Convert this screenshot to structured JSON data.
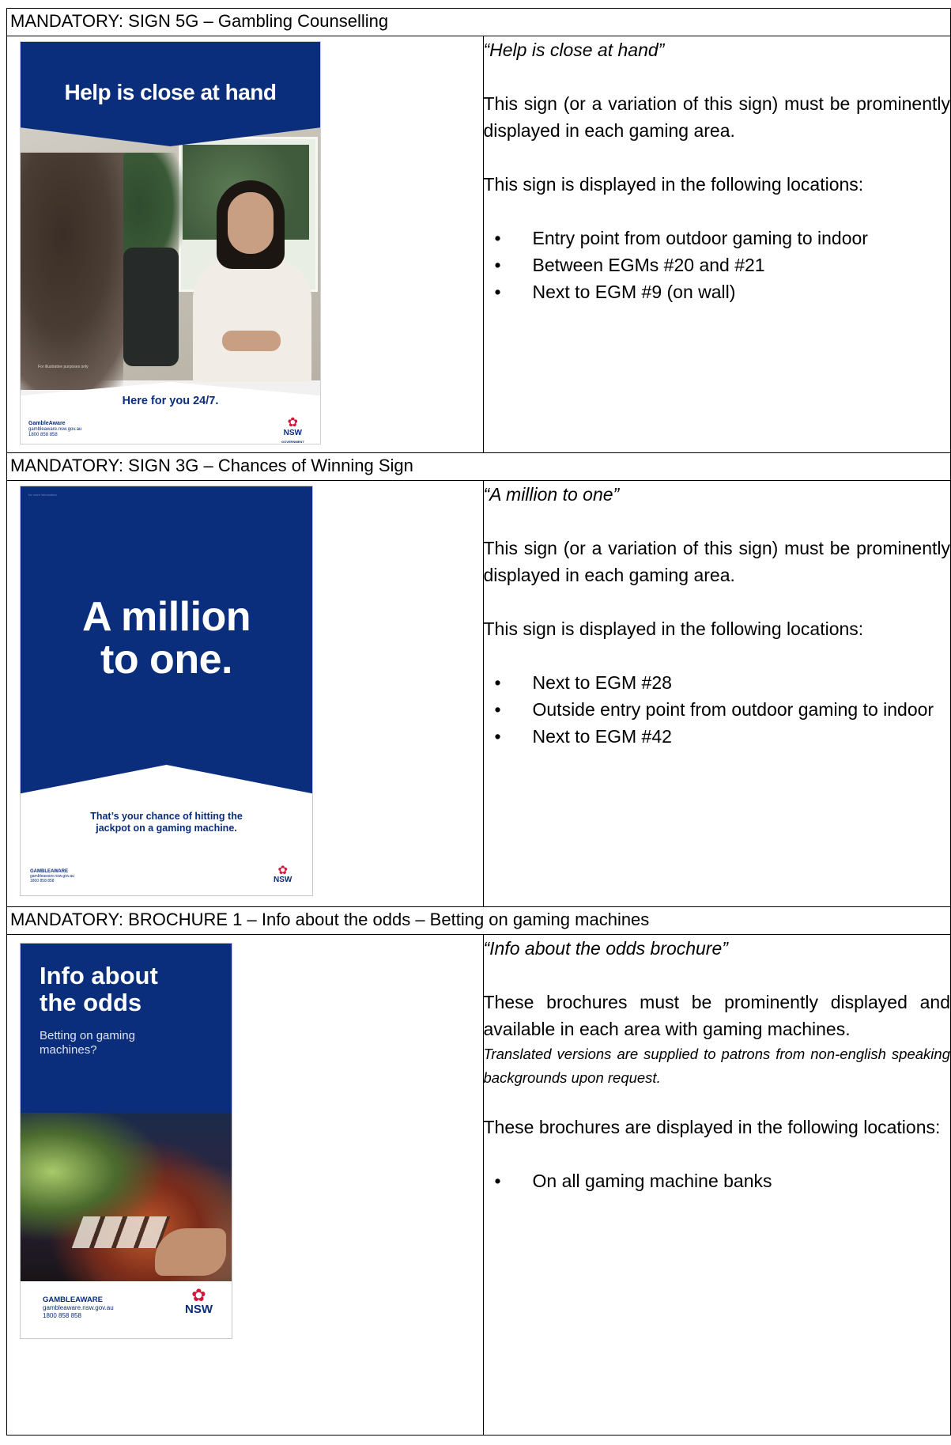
{
  "sections": [
    {
      "header": "MANDATORY: SIGN 5G – Gambling Counselling",
      "poster": {
        "title": "Help is close at hand",
        "tagline": "Here for you 24/7.",
        "gambleaware": "GambleAware",
        "gambleaware_web": "gambleaware.nsw.gov.au",
        "gambleaware_phone": "1800 858 858",
        "nsw": "NSW",
        "nsw_sub": "GOVERNMENT",
        "photo_caption": "For illustrative purposes only"
      },
      "quote": "“Help is close at hand”",
      "para1": "This sign (or a variation of this sign) must be prominently displayed in each gaming area.",
      "para2": "This sign is displayed in the following locations:",
      "locations": [
        "Entry point from outdoor gaming to indoor",
        "Between EGMs #20 and #21",
        "Next to EGM #9 (on wall)"
      ]
    },
    {
      "header": "MANDATORY: SIGN 3G – Chances of Winning Sign",
      "poster": {
        "line1": "A million",
        "line2": "to one.",
        "tag1": "That’s your chance of hitting the",
        "tag2": "jackpot on a gaming machine.",
        "gambleaware": "GAMBLEAWARE",
        "gambleaware_web": "gambleaware.nsw.gov.au",
        "gambleaware_phone": "1800 858 858",
        "nsw": "NSW",
        "tiny": "for more information"
      },
      "quote": "“A million to one”",
      "para1": "This sign (or a variation of this sign) must be prominently displayed in each gaming area.",
      "para2": "This sign is displayed in the following locations:",
      "locations": [
        "Next to EGM #28",
        "Outside entry point from outdoor gaming to indoor",
        "Next to EGM #42"
      ]
    },
    {
      "header": "MANDATORY: BROCHURE 1 – Info about the odds – Betting on gaming machines",
      "poster": {
        "title1": "Info about",
        "title2": "the odds",
        "sub1": "Betting on gaming",
        "sub2": "machines?",
        "gambleaware": "GAMBLEAWARE",
        "gambleaware_web": "gambleaware.nsw.gov.au",
        "gambleaware_phone": "1800 858 858",
        "nsw": "NSW"
      },
      "quote": "“Info about the odds brochure”",
      "para1": "These brochures must be prominently displayed and available in each area with gaming machines.",
      "note": "Translated versions are supplied to patrons from non-english speaking backgrounds upon request.",
      "para2": "These brochures are displayed in the following locations:",
      "locations": [
        "On all gaming machine banks"
      ]
    }
  ]
}
